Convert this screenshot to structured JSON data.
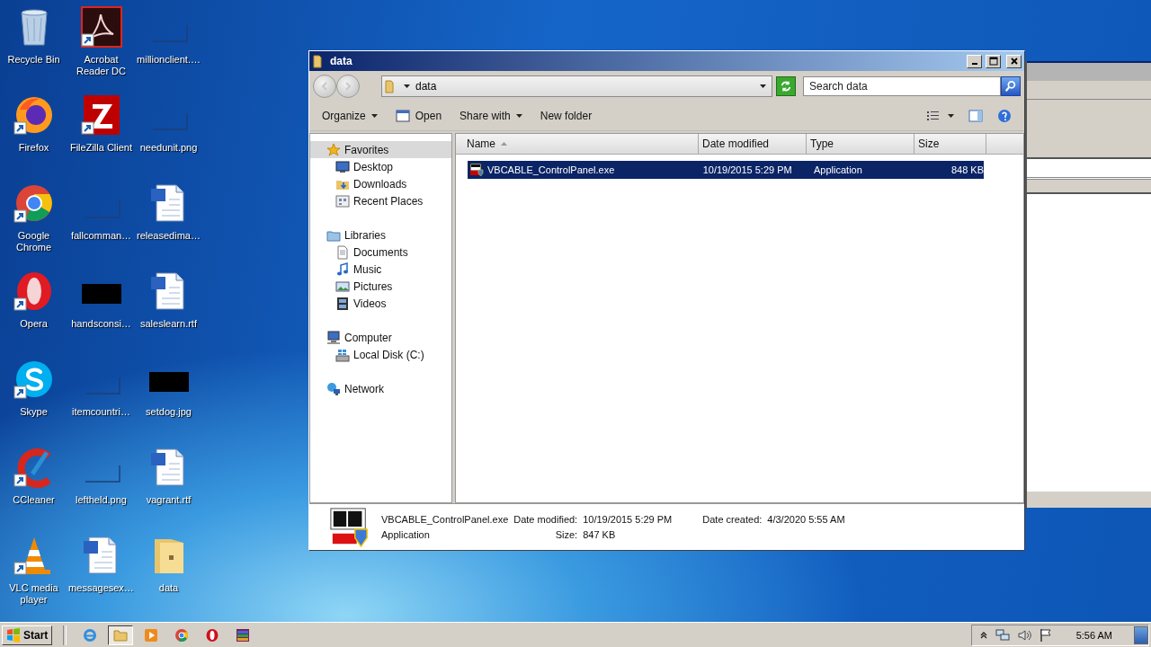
{
  "desktop": {
    "icons": [
      {
        "label": "Recycle Bin",
        "kind": "recycle",
        "shortcut": false
      },
      {
        "label": "Acrobat Reader DC",
        "kind": "acrobat",
        "shortcut": true
      },
      {
        "label": "millionclient.…",
        "kind": "blank",
        "shortcut": false
      },
      {
        "label": "Firefox",
        "kind": "firefox",
        "shortcut": true
      },
      {
        "label": "FileZilla Client",
        "kind": "filezilla",
        "shortcut": true
      },
      {
        "label": "needunit.png",
        "kind": "blank",
        "shortcut": false
      },
      {
        "label": "Google Chrome",
        "kind": "chrome",
        "shortcut": true
      },
      {
        "label": "fallcomman…",
        "kind": "blank",
        "shortcut": false
      },
      {
        "label": "releasedima…",
        "kind": "word",
        "shortcut": false
      },
      {
        "label": "Opera",
        "kind": "opera",
        "shortcut": true
      },
      {
        "label": "handsconsi…",
        "kind": "black",
        "shortcut": false
      },
      {
        "label": "saleslearn.rtf",
        "kind": "word",
        "shortcut": false
      },
      {
        "label": "Skype",
        "kind": "skype",
        "shortcut": true
      },
      {
        "label": "itemcountri…",
        "kind": "blank",
        "shortcut": false
      },
      {
        "label": "setdog.jpg",
        "kind": "black",
        "shortcut": false
      },
      {
        "label": "CCleaner",
        "kind": "ccleaner",
        "shortcut": true
      },
      {
        "label": "leftheld.png",
        "kind": "blank",
        "shortcut": false
      },
      {
        "label": "vagrant.rtf",
        "kind": "word",
        "shortcut": false
      },
      {
        "label": "VLC media player",
        "kind": "vlc",
        "shortcut": true
      },
      {
        "label": "messagesex…",
        "kind": "word",
        "shortcut": false
      },
      {
        "label": "data",
        "kind": "folder",
        "shortcut": false
      }
    ]
  },
  "explorer": {
    "title": "data",
    "address": "data",
    "search": {
      "placeholder": "Search data"
    },
    "toolbar": [
      {
        "label": "Organize",
        "kind": "menu"
      },
      {
        "label": "Open",
        "kind": "open"
      },
      {
        "label": "Share with",
        "kind": "menu"
      },
      {
        "label": "New folder",
        "kind": "plain"
      }
    ],
    "nav": [
      {
        "label": "Favorites",
        "kind": "star",
        "selected": true,
        "children": [
          {
            "label": "Desktop",
            "kind": "desktop",
            "selected": false
          },
          {
            "label": "Downloads",
            "kind": "downloads",
            "selected": false
          },
          {
            "label": "Recent Places",
            "kind": "recent",
            "selected": false
          }
        ]
      },
      {
        "label": "Libraries",
        "kind": "library",
        "selected": false,
        "children": [
          {
            "label": "Documents",
            "kind": "doc",
            "selected": false
          },
          {
            "label": "Music",
            "kind": "music",
            "selected": false
          },
          {
            "label": "Pictures",
            "kind": "pictures",
            "selected": false
          },
          {
            "label": "Videos",
            "kind": "videos",
            "selected": false
          }
        ]
      },
      {
        "label": "Computer",
        "kind": "computer",
        "selected": false,
        "children": [
          {
            "label": "Local Disk (C:)",
            "kind": "disk",
            "selected": false
          }
        ]
      },
      {
        "label": "Network",
        "kind": "network",
        "selected": false
      }
    ],
    "columns": [
      {
        "label": "Name",
        "sorted": true
      },
      {
        "label": "Date modified",
        "sorted": false
      },
      {
        "label": "Type",
        "sorted": false
      },
      {
        "label": "Size",
        "sorted": false
      }
    ],
    "files": [
      {
        "name": "VBCABLE_ControlPanel.exe",
        "date": "10/19/2015 5:29 PM",
        "type": "Application",
        "size": "848 KB",
        "selected": true
      }
    ],
    "details": {
      "name": "VBCABLE_ControlPanel.exe",
      "type": "Application",
      "modified_label": "Date modified:",
      "modified": "10/19/2015 5:29 PM",
      "size_label": "Size:",
      "size": "847 KB",
      "created_label": "Date created:",
      "created": "4/3/2020 5:55 AM"
    }
  },
  "taskbar": {
    "start": "Start",
    "apps": [
      {
        "kind": "ie",
        "active": false
      },
      {
        "kind": "explorer",
        "active": true
      },
      {
        "kind": "media",
        "active": false
      },
      {
        "kind": "chrome",
        "active": false
      },
      {
        "kind": "opera",
        "active": false
      },
      {
        "kind": "archive",
        "active": false
      }
    ],
    "clock": "5:56 AM"
  }
}
